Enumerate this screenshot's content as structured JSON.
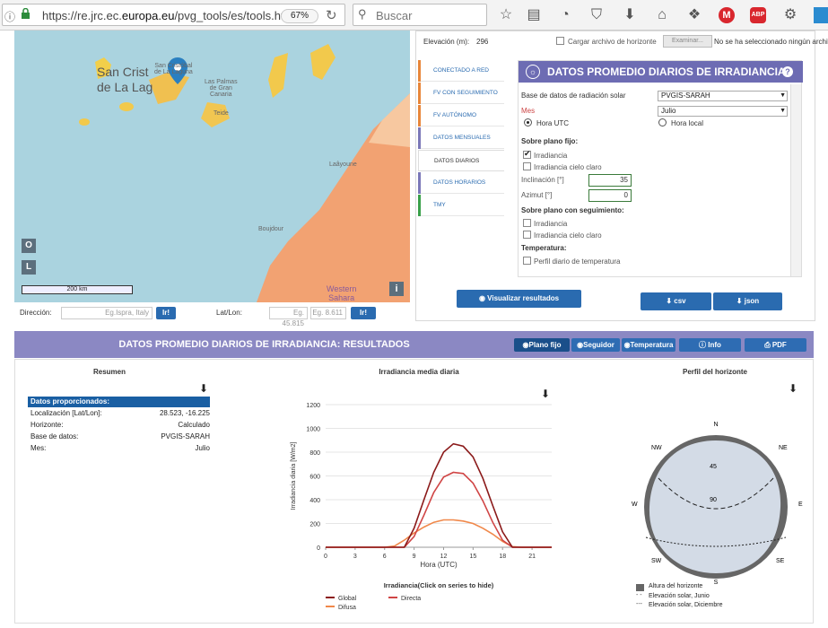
{
  "browser": {
    "url_prefix": "https://re.jrc.ec.",
    "url_domain": "europa.eu",
    "url_path": "/pvg_tools/es/tools.ht",
    "zoom": "67%",
    "search_placeholder": "Buscar",
    "icons": [
      "info-icon",
      "lock-icon",
      "reload-icon",
      "search-icon",
      "star-icon",
      "reader-icon",
      "history-icon",
      "pocket-icon",
      "download-icon",
      "home-icon",
      "extension-icon",
      "mega-icon",
      "adblock-icon",
      "settings-icon"
    ]
  },
  "map": {
    "places": [
      "San Crist",
      "de La Lag",
      "San Cristóbal",
      "de La Laguna",
      "Las Palmas",
      "de Gran",
      "Canaria",
      "Teide",
      "Laâyoune",
      "Boujdour",
      "Western",
      "Sahara"
    ],
    "ctrl_o": "O",
    "ctrl_l": "L",
    "info": "i",
    "scale": "200 km"
  },
  "address": {
    "direccion_label": "Dirección:",
    "direccion_placeholder": "Eg.Ispra, Italy",
    "go1": "Ir!",
    "latlon_label": "Lat/Lon:",
    "lat_placeholder": "Eg. 45.815",
    "lon_placeholder": "Eg. 8.611",
    "go2": "Ir!"
  },
  "top_strip": {
    "elevacion_label": "Elevación (m):",
    "elevacion_value": "296",
    "horizon_label": "Cargar archivo de horizonte",
    "examinar": "Examinar...",
    "no_file": "No se ha seleccionado ningún archivo"
  },
  "tabs": [
    {
      "label": "Conectado a red",
      "color": "#e8863a"
    },
    {
      "label": "FV con seguimiento",
      "color": "#e8863a"
    },
    {
      "label": "FV autónomo",
      "color": "#e8863a"
    },
    {
      "label": "Datos mensuales",
      "color": "#7b78b8"
    },
    {
      "label": "Datos diarios",
      "color": "#7b78b8"
    },
    {
      "label": "Datos horarios",
      "color": "#7b78b8"
    },
    {
      "label": "TMY",
      "color": "#3aa04a"
    }
  ],
  "form": {
    "title": "DATOS PROMEDIO DIARIOS DE IRRADIANCIA",
    "help": "?",
    "db_label": "Base de datos de radiación solar",
    "db_value": "PVGIS-SARAH",
    "mes_label": "Mes",
    "mes_value": "Julio",
    "hora_utc": "Hora UTC",
    "hora_local": "Hora local",
    "plano_fijo": "Sobre plano fijo:",
    "irradiancia": "Irradiancia",
    "irradiancia_cielo": "Irradiancia cielo claro",
    "inclinacion_label": "Inclinación [°]",
    "inclinacion_value": "35",
    "azimut_label": "Azimut [°]",
    "azimut_value": "0",
    "plano_seg": "Sobre plano con seguimiento:",
    "irradiancia2": "Irradiancia",
    "irradiancia_cielo2": "Irradiancia cielo claro",
    "temperatura": "Temperatura:",
    "perfil_temp": "Perfil diario de temperatura"
  },
  "actions": {
    "visualizar": "Visualizar resultados",
    "csv": "csv",
    "json": "json"
  },
  "results": {
    "title": "DATOS PROMEDIO DIARIOS DE IRRADIANCIA: RESULTADOS",
    "buttons": [
      "Plano fijo",
      "Seguidor",
      "Temperatura",
      "Info",
      "PDF"
    ]
  },
  "summary": {
    "title": "Resumen",
    "head": "Datos proporcionados:",
    "rows": [
      {
        "k": "Localización [Lat/Lon]:",
        "v": "28.523, -16.225"
      },
      {
        "k": "Horizonte:",
        "v": "Calculado"
      },
      {
        "k": "Base de datos:",
        "v": "PVGIS-SARAH"
      },
      {
        "k": "Mes:",
        "v": "Julio"
      }
    ]
  },
  "chart_data": {
    "type": "line",
    "title": "Irradiancia media diaria",
    "xlabel": "Hora (UTC)",
    "ylabel": "Irradiancia diaria [W/m2]",
    "xlim": [
      0,
      23
    ],
    "ylim": [
      0,
      1200
    ],
    "xticks": [
      0,
      3,
      6,
      9,
      12,
      15,
      18,
      21
    ],
    "yticks": [
      0,
      200,
      400,
      600,
      800,
      1000,
      1200
    ],
    "legend_title": "Irradiancia(Click on series to hide)",
    "x": [
      0,
      1,
      2,
      3,
      4,
      5,
      6,
      7,
      8,
      9,
      10,
      11,
      12,
      13,
      14,
      15,
      16,
      17,
      18,
      19,
      20,
      21,
      22,
      23
    ],
    "series": [
      {
        "name": "Global",
        "color": "#8b1a1a",
        "values": [
          0,
          0,
          0,
          0,
          0,
          0,
          0,
          0,
          0,
          160,
          400,
          630,
          800,
          870,
          850,
          760,
          580,
          350,
          130,
          0,
          0,
          0,
          0,
          0
        ]
      },
      {
        "name": "Directa",
        "color": "#d04545",
        "values": [
          0,
          0,
          0,
          0,
          0,
          0,
          0,
          0,
          0,
          90,
          270,
          460,
          590,
          630,
          620,
          540,
          390,
          210,
          60,
          0,
          0,
          0,
          0,
          0
        ]
      },
      {
        "name": "Difusa",
        "color": "#f0884a",
        "values": [
          0,
          0,
          0,
          0,
          0,
          0,
          0,
          10,
          60,
          120,
          170,
          210,
          230,
          230,
          220,
          200,
          160,
          110,
          50,
          5,
          0,
          0,
          0,
          0
        ]
      }
    ]
  },
  "horizon": {
    "title": "Perfil del horizonte",
    "dirs": [
      "N",
      "NE",
      "E",
      "SE",
      "S",
      "SW",
      "W",
      "NW"
    ],
    "rings": [
      "45",
      "90"
    ],
    "legend": [
      "Altura del horizonte",
      "Elevación solar, Junio",
      "Elevación solar, Diciembre"
    ]
  },
  "colors": {
    "accent": "#2a6bb0",
    "header": "#6d6cb3",
    "results_bar": "#8b88c3"
  }
}
